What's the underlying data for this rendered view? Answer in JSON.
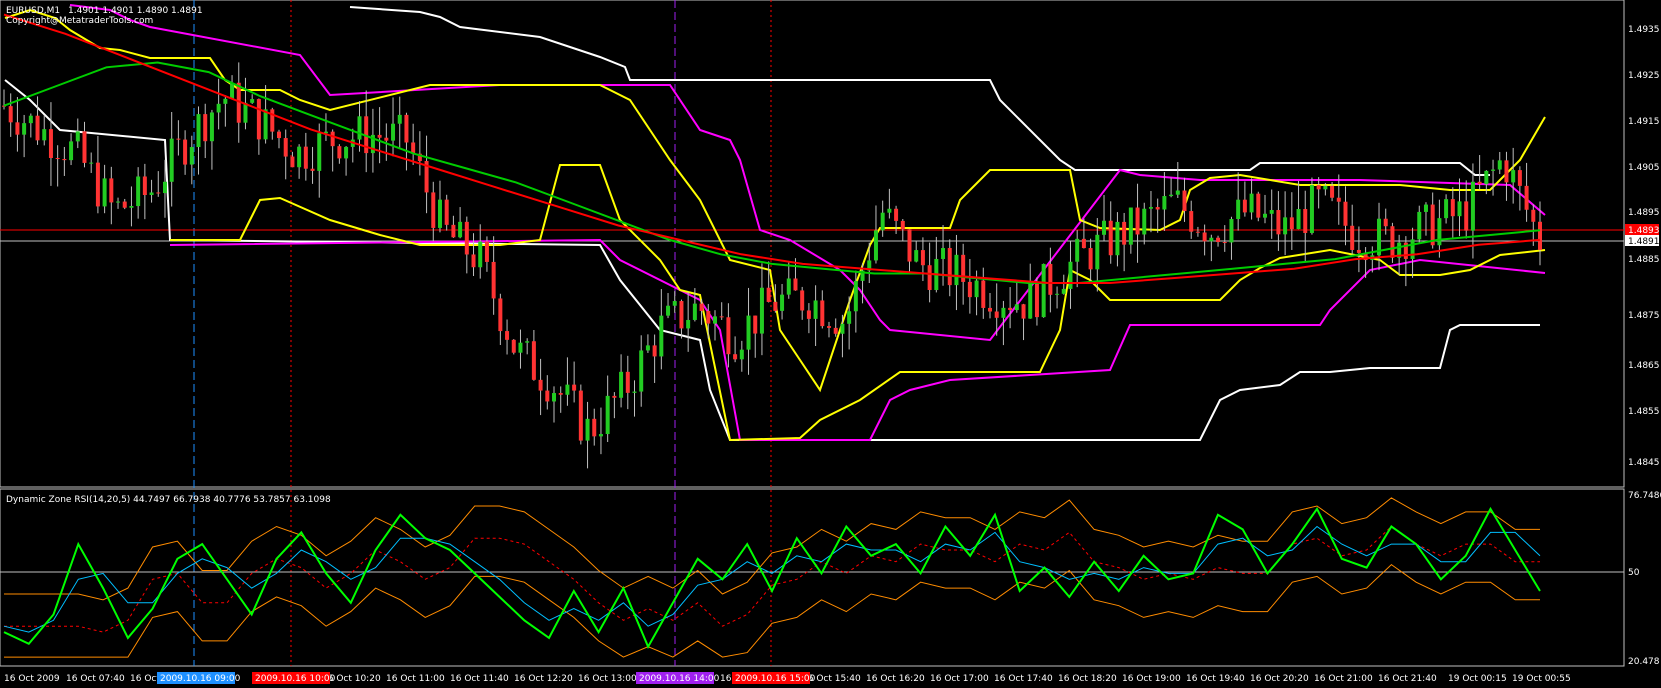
{
  "header": {
    "symbol": "EURUSD,M1",
    "ohlc": "1.4901 1.4901 1.4890 1.4891",
    "copyright": "Copyright@MetatraderTools.com"
  },
  "indicator_label": "Dynamic Zone RSI(14,20,5) 44.7497 66.7938 40.7776 53.7857 63.1098",
  "price_axis": {
    "ticks": [
      "1.4935",
      "1.4925",
      "1.4915",
      "1.4905",
      "1.4895",
      "1.4885",
      "1.4875",
      "1.4865",
      "1.4855",
      "1.4845"
    ],
    "current_bid": "1.4891",
    "red_line_label": "1.4893"
  },
  "rsi_axis": {
    "top": "76.7486",
    "mid": "50",
    "bottom": "20.478"
  },
  "time_axis": {
    "labels": [
      "16 Oct 2009",
      "16 Oct 07:40",
      "16 Oct",
      "16 Oct 10:20",
      "16 Oct 11:00",
      "16 Oct 11:40",
      "16 Oct 12:20",
      "16 Oct 13:00",
      "16 Oct",
      "16 Oct 15:40",
      "16 Oct 16:20",
      "16 Oct 17:00",
      "16 Oct 17:40",
      "16 Oct 18:20",
      "16 Oct 19:00",
      "16 Oct 19:40",
      "16 Oct 20:20",
      "16 Oct 21:00",
      "16 Oct 21:40",
      "19 Oct 00:15",
      "19 Oct 00:55"
    ],
    "session_markers": [
      {
        "label": "2009.10.16 09:00",
        "color": "#1e90ff"
      },
      {
        "label": "2009.10.16 10:00",
        "color": "#ff0000"
      },
      {
        "label": "2009.10.16 14:00",
        "color": "#a020f0"
      },
      {
        "label": "2009.10.16 15:00",
        "color": "#ff0000"
      }
    ]
  },
  "colors": {
    "background": "#000000",
    "bull_candle": "#22cc22",
    "bear_candle": "#ff3333",
    "ma_fast": "#00cc00",
    "ma_slow": "#ff0000",
    "donchian_outer": "#ffffff",
    "donchian_mid": "#ff00ff",
    "donchian_inner": "#ffff00",
    "rsi": "#00ff00",
    "rsi_signal": "#00bfff",
    "rsi_bands": "#ff8c00",
    "rsi_mid": "#ff0000"
  },
  "chart_data": {
    "type": "line",
    "price_ylim": [
      1.4843,
      1.494
    ],
    "rsi_ylim": [
      20.478,
      76.7486
    ],
    "series": [
      {
        "values": [
          1.4919,
          1.4914,
          1.4909,
          1.4897,
          1.4901,
          1.4912,
          1.4921,
          1.4916,
          1.4909,
          1.4912,
          1.4913,
          1.4912,
          1.4893,
          1.4887,
          1.4868,
          1.4861,
          1.4851,
          1.486,
          1.4873,
          1.4877,
          1.4871,
          1.4878,
          1.4879,
          1.4874,
          1.4897,
          1.4886,
          1.4884,
          1.488,
          1.4878,
          1.4885,
          1.489,
          1.4894,
          1.4899,
          1.4893,
          1.4897,
          1.4893,
          1.4899,
          1.4892,
          1.4891,
          1.4894,
          1.4897,
          1.4908,
          1.4891
        ]
      },
      {
        "values": [
          1.4919,
          1.4923,
          1.4927,
          1.4928,
          1.4926,
          1.4921,
          1.4917,
          1.4913,
          1.4909,
          1.4906,
          1.4903,
          1.4899,
          1.4895,
          1.4891,
          1.4888,
          1.4886,
          1.4885,
          1.4884,
          1.4884,
          1.4883,
          1.4882,
          1.4882,
          1.4883,
          1.4884,
          1.4885,
          1.4886,
          1.4887,
          1.4889,
          1.4891,
          1.4892,
          1.4893
        ]
      },
      {
        "values": [
          1.4938,
          1.4934,
          1.4929,
          1.4924,
          1.4919,
          1.4914,
          1.491,
          1.4906,
          1.4902,
          1.4898,
          1.4894,
          1.4891,
          1.4888,
          1.4886,
          1.4885,
          1.4884,
          1.4883,
          1.4882,
          1.4882,
          1.4883,
          1.4884,
          1.4885,
          1.4887,
          1.4888,
          1.489,
          1.4891
        ]
      }
    ],
    "rsi_series": [
      {
        "values": [
          30,
          26,
          36,
          60,
          45,
          28,
          38,
          55,
          60,
          48,
          36,
          55,
          64,
          50,
          40,
          58,
          70,
          62,
          58,
          50,
          42,
          34,
          28,
          44,
          30,
          45,
          25,
          40,
          55,
          48,
          60,
          44,
          62,
          50,
          66,
          56,
          60,
          50,
          66,
          56,
          70,
          44,
          52,
          42,
          54,
          44,
          56,
          48,
          50,
          70,
          65,
          50,
          60,
          72,
          55,
          52,
          66,
          60,
          48,
          56,
          72,
          58,
          44
        ]
      },
      {
        "values": [
          32,
          30,
          34,
          48,
          50,
          40,
          40,
          50,
          55,
          52,
          45,
          50,
          58,
          54,
          48,
          52,
          62,
          62,
          60,
          54,
          48,
          40,
          34,
          38,
          34,
          40,
          32,
          36,
          46,
          48,
          54,
          50,
          56,
          54,
          60,
          58,
          58,
          54,
          60,
          58,
          64,
          54,
          52,
          48,
          50,
          48,
          52,
          50,
          50,
          60,
          62,
          56,
          58,
          66,
          60,
          56,
          60,
          60,
          54,
          54,
          64,
          64,
          56
        ]
      }
    ]
  }
}
